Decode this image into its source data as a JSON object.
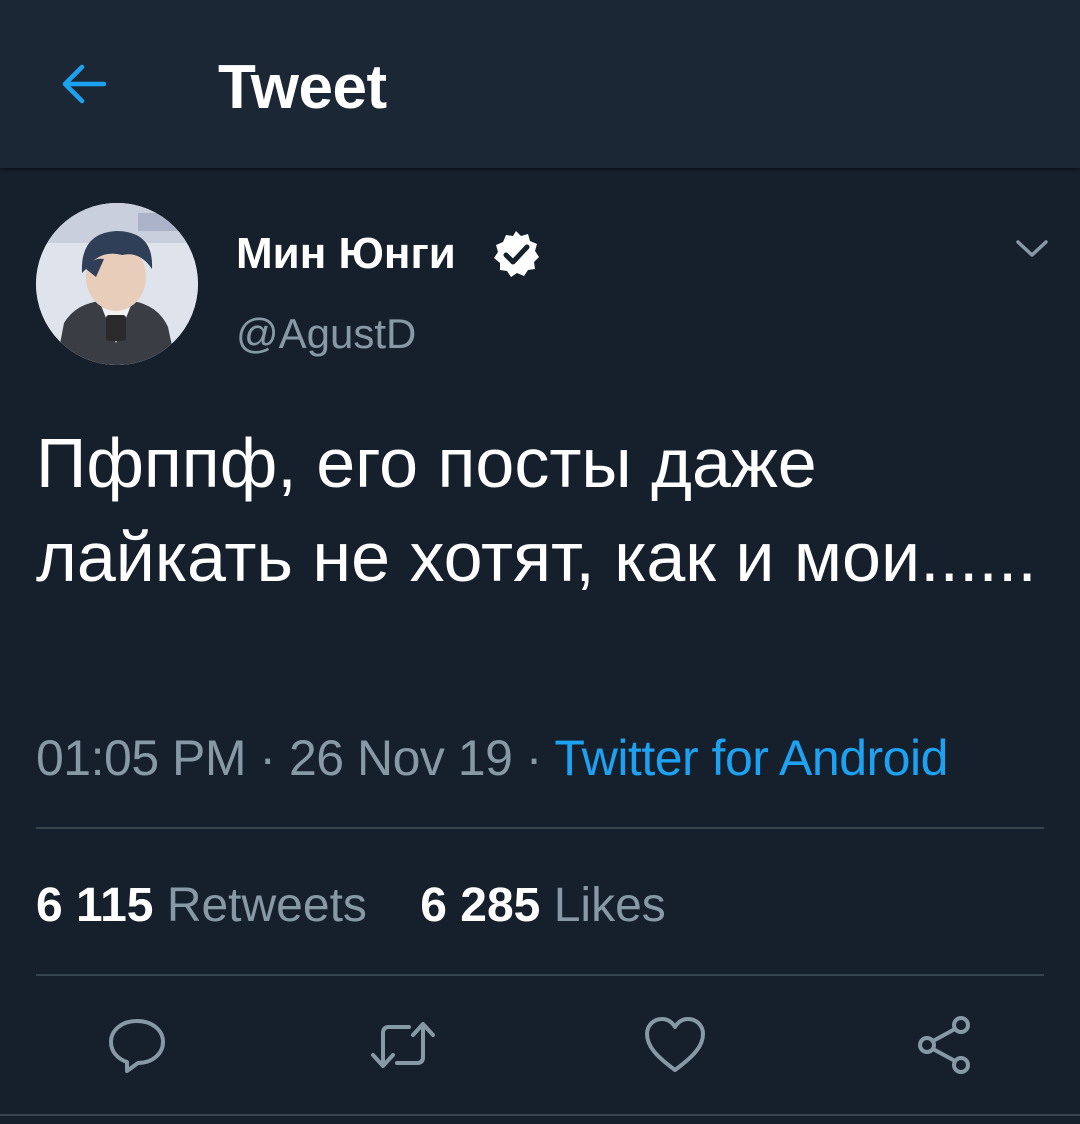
{
  "header": {
    "title": "Tweet",
    "back_icon": "arrow-left-icon"
  },
  "colors": {
    "background": "#16202c",
    "header_background": "#1b2735",
    "accent": "#1da1f2",
    "secondary_text": "#8899a6",
    "divider": "#38444d"
  },
  "tweet": {
    "author": {
      "display_name": "Мин Юнги",
      "handle": "@AgustD",
      "verified": true,
      "verified_icon": "verified-badge-icon",
      "avatar_icon": "avatar"
    },
    "menu_icon": "chevron-down-icon",
    "text": "Пфппф, его посты даже лайкать не хотят, как и мои......",
    "time": "01:05 PM",
    "date": "26 Nov 19",
    "separator": " · ",
    "source": "Twitter for Android",
    "retweets_count": "6 115",
    "retweets_label": "Retweets",
    "likes_count": "6 285",
    "likes_label": "Likes"
  },
  "actions": [
    {
      "name": "reply",
      "icon": "reply-icon"
    },
    {
      "name": "retweet",
      "icon": "retweet-icon"
    },
    {
      "name": "like",
      "icon": "heart-icon"
    },
    {
      "name": "share",
      "icon": "share-icon"
    }
  ]
}
